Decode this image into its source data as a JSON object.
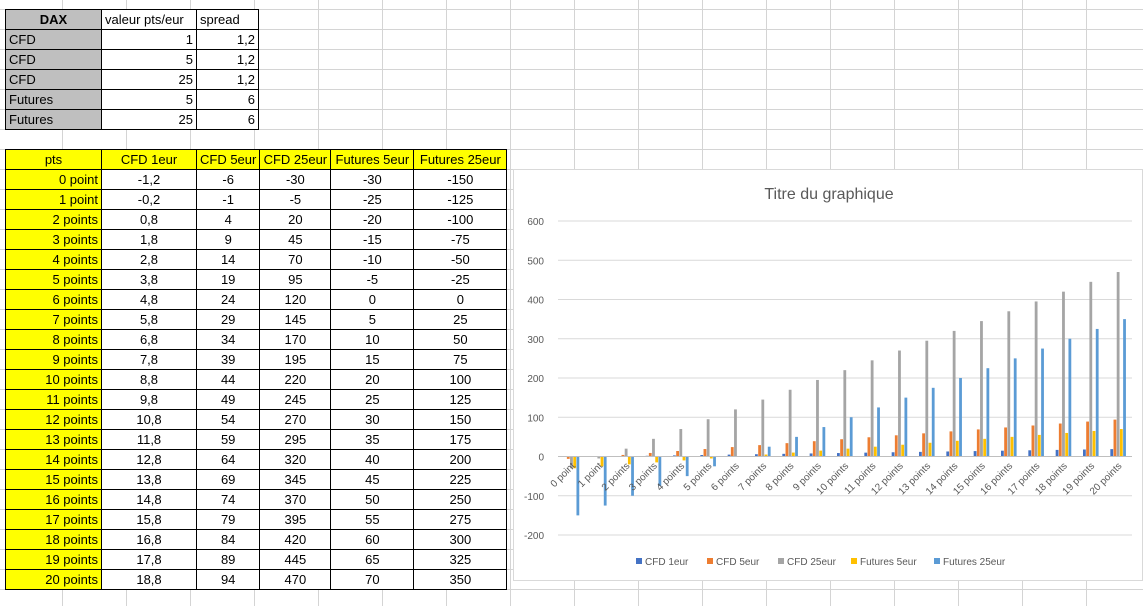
{
  "dax_table": {
    "headers": [
      "DAX",
      "valeur pts/eur",
      "spread"
    ],
    "rows": [
      [
        "CFD",
        "1",
        "1,2"
      ],
      [
        "CFD",
        "5",
        "1,2"
      ],
      [
        "CFD",
        "25",
        "1,2"
      ],
      [
        "Futures",
        "5",
        "6"
      ],
      [
        "Futures",
        "25",
        "6"
      ]
    ]
  },
  "pts_table": {
    "headers": [
      "pts",
      "CFD 1eur",
      "CFD 5eur",
      "CFD 25eur",
      "Futures 5eur",
      "Futures 25eur"
    ],
    "rows": [
      [
        "0 point",
        "-1,2",
        "-6",
        "-30",
        "-30",
        "-150"
      ],
      [
        "1 point",
        "-0,2",
        "-1",
        "-5",
        "-25",
        "-125"
      ],
      [
        "2 points",
        "0,8",
        "4",
        "20",
        "-20",
        "-100"
      ],
      [
        "3 points",
        "1,8",
        "9",
        "45",
        "-15",
        "-75"
      ],
      [
        "4 points",
        "2,8",
        "14",
        "70",
        "-10",
        "-50"
      ],
      [
        "5 points",
        "3,8",
        "19",
        "95",
        "-5",
        "-25"
      ],
      [
        "6 points",
        "4,8",
        "24",
        "120",
        "0",
        "0"
      ],
      [
        "7 points",
        "5,8",
        "29",
        "145",
        "5",
        "25"
      ],
      [
        "8 points",
        "6,8",
        "34",
        "170",
        "10",
        "50"
      ],
      [
        "9 points",
        "7,8",
        "39",
        "195",
        "15",
        "75"
      ],
      [
        "10 points",
        "8,8",
        "44",
        "220",
        "20",
        "100"
      ],
      [
        "11 points",
        "9,8",
        "49",
        "245",
        "25",
        "125"
      ],
      [
        "12 points",
        "10,8",
        "54",
        "270",
        "30",
        "150"
      ],
      [
        "13 points",
        "11,8",
        "59",
        "295",
        "35",
        "175"
      ],
      [
        "14 points",
        "12,8",
        "64",
        "320",
        "40",
        "200"
      ],
      [
        "15 points",
        "13,8",
        "69",
        "345",
        "45",
        "225"
      ],
      [
        "16 points",
        "14,8",
        "74",
        "370",
        "50",
        "250"
      ],
      [
        "17 points",
        "15,8",
        "79",
        "395",
        "55",
        "275"
      ],
      [
        "18 points",
        "16,8",
        "84",
        "420",
        "60",
        "300"
      ],
      [
        "19 points",
        "17,8",
        "89",
        "445",
        "65",
        "325"
      ],
      [
        "20 points",
        "18,8",
        "94",
        "470",
        "70",
        "350"
      ]
    ]
  },
  "chart_data": {
    "type": "bar",
    "title": "Titre du graphique",
    "xlabel": "",
    "ylabel": "",
    "ylim": [
      -200,
      600
    ],
    "yticks": [
      "600",
      "500",
      "400",
      "300",
      "200",
      "100",
      "0",
      "-100",
      "-200"
    ],
    "grid": true,
    "legend_position": "bottom",
    "categories": [
      "0 point",
      "1 point",
      "2 points",
      "3 points",
      "4 points",
      "5 points",
      "6 points",
      "7 points",
      "8 points",
      "9 points",
      "10 points",
      "11 points",
      "12 points",
      "13 points",
      "14 points",
      "15 points",
      "16 points",
      "17 points",
      "18 points",
      "19 points",
      "20 points"
    ],
    "series": [
      {
        "name": "CFD 1eur",
        "color": "#4472c4",
        "values": [
          -1.2,
          -0.2,
          0.8,
          1.8,
          2.8,
          3.8,
          4.8,
          5.8,
          6.8,
          7.8,
          8.8,
          9.8,
          10.8,
          11.8,
          12.8,
          13.8,
          14.8,
          15.8,
          16.8,
          17.8,
          18.8
        ]
      },
      {
        "name": "CFD 5eur",
        "color": "#ed7d31",
        "values": [
          -6,
          -1,
          4,
          9,
          14,
          19,
          24,
          29,
          34,
          39,
          44,
          49,
          54,
          59,
          64,
          69,
          74,
          79,
          84,
          89,
          94
        ]
      },
      {
        "name": "CFD 25eur",
        "color": "#a5a5a5",
        "values": [
          -30,
          -5,
          20,
          45,
          70,
          95,
          120,
          145,
          170,
          195,
          220,
          245,
          270,
          295,
          320,
          345,
          370,
          395,
          420,
          445,
          470
        ]
      },
      {
        "name": "Futures 5eur",
        "color": "#ffc000",
        "values": [
          -30,
          -25,
          -20,
          -15,
          -10,
          -5,
          0,
          5,
          10,
          15,
          20,
          25,
          30,
          35,
          40,
          45,
          50,
          55,
          60,
          65,
          70
        ]
      },
      {
        "name": "Futures 25eur",
        "color": "#5b9bd5",
        "values": [
          -150,
          -125,
          -100,
          -75,
          -50,
          -25,
          0,
          25,
          50,
          75,
          100,
          125,
          150,
          175,
          200,
          225,
          250,
          275,
          300,
          325,
          350
        ]
      }
    ]
  }
}
